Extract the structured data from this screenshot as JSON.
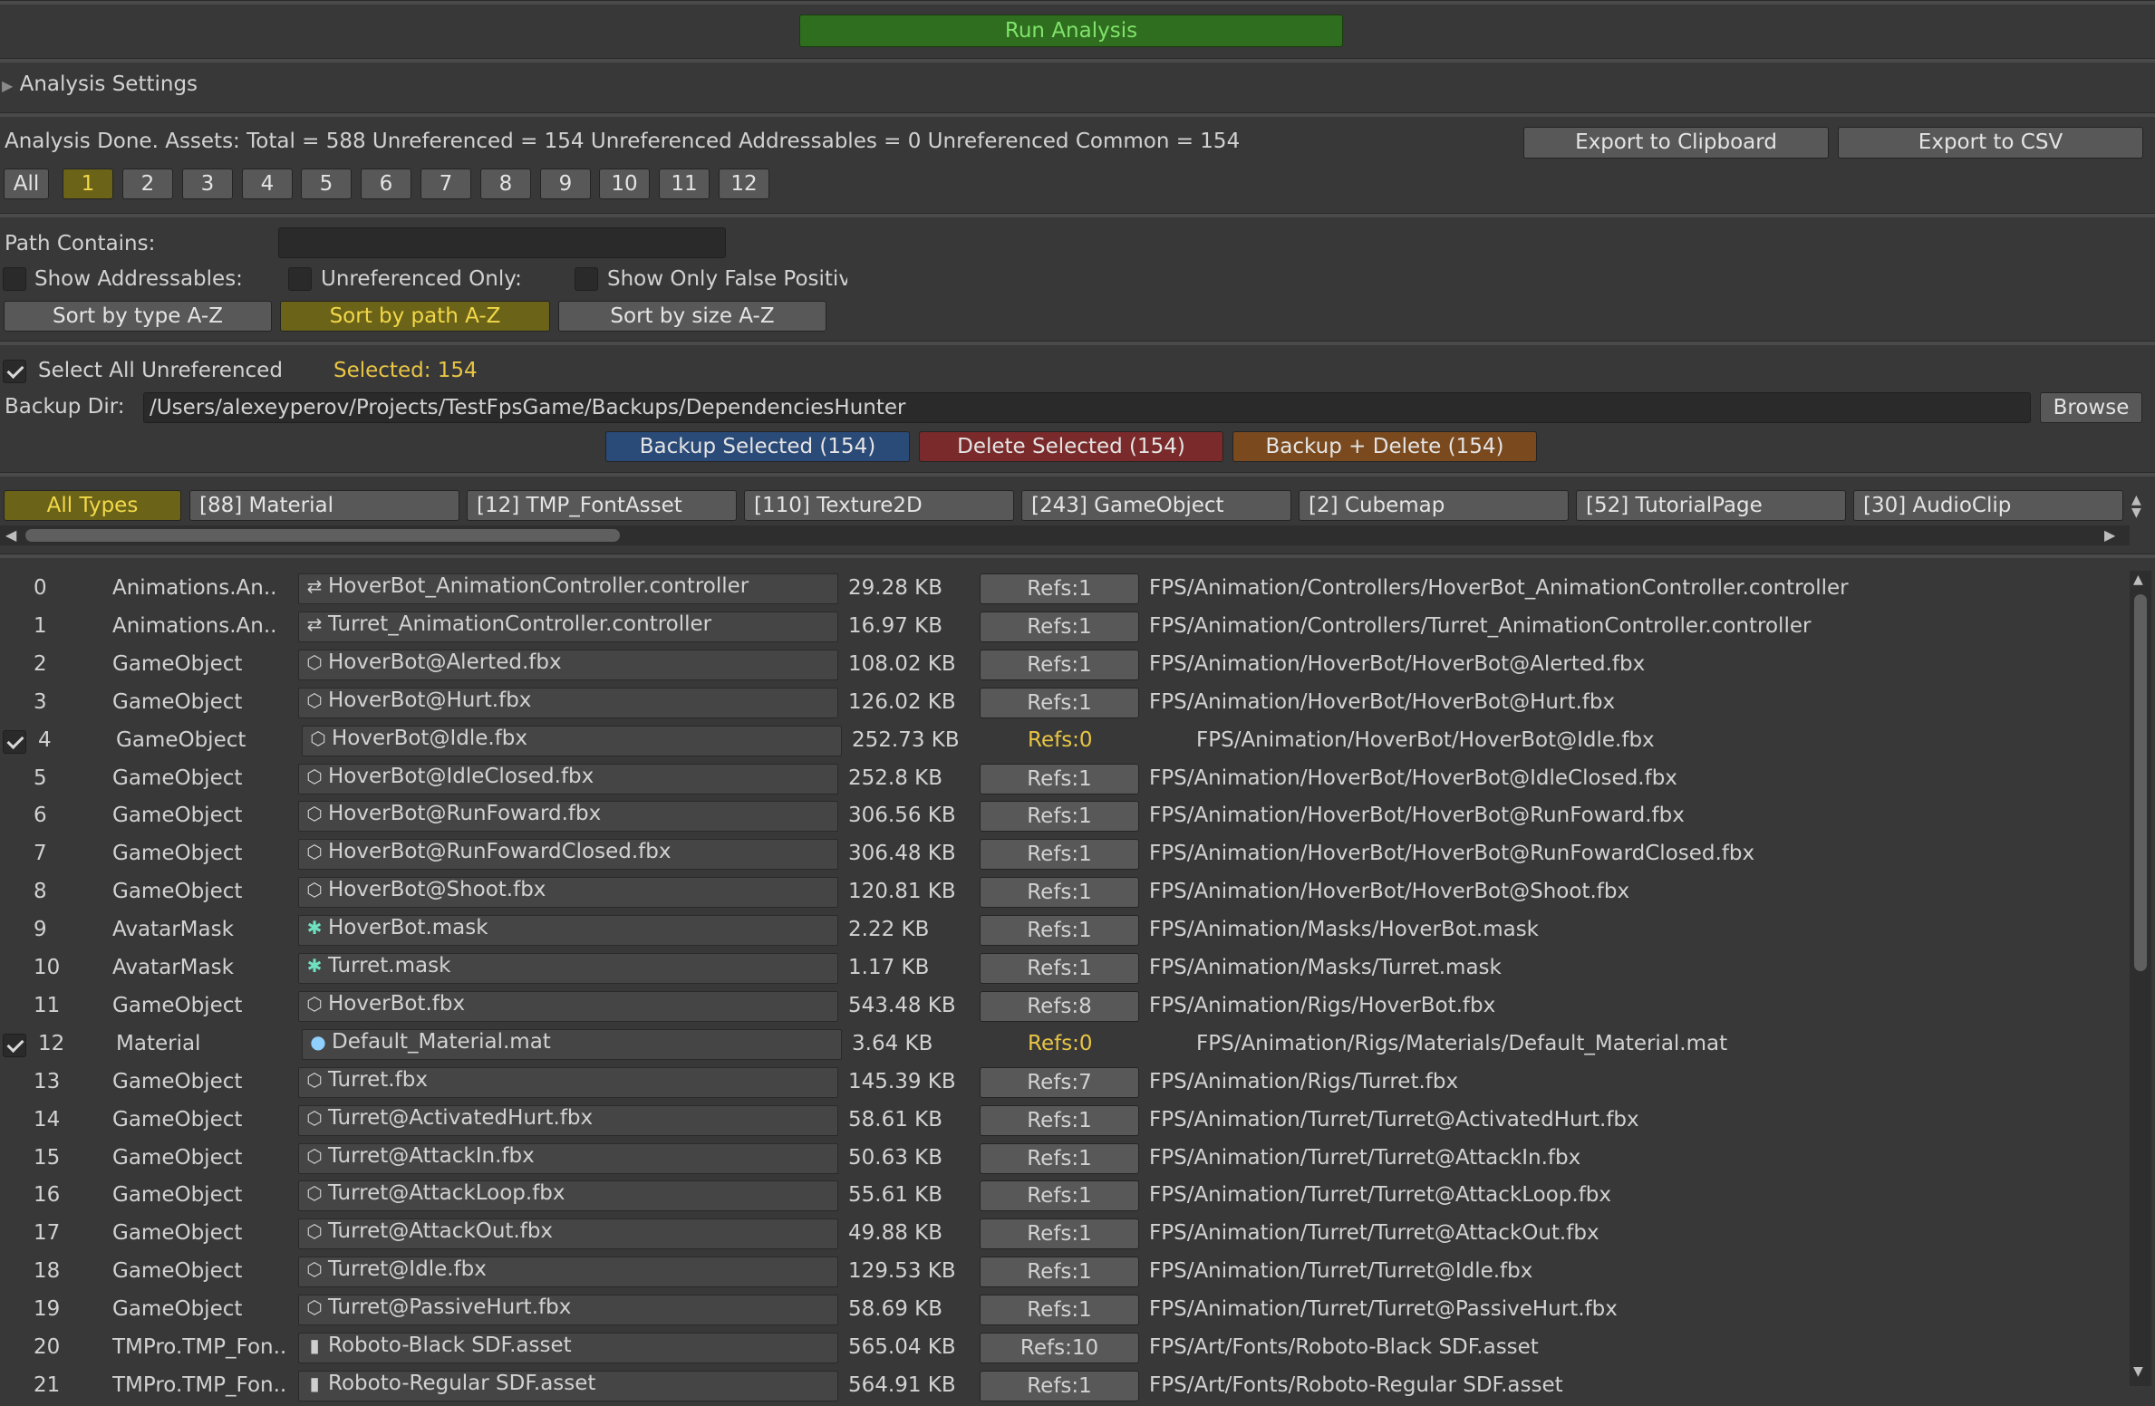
{
  "run_button": "Run Analysis",
  "settings_foldout": "Analysis Settings",
  "status_text": "Analysis Done. Assets: Total = 588 Unreferenced = 154 Unreferenced Addressables = 0 Unreferenced Common = 154",
  "export_clipboard": "Export to Clipboard",
  "export_csv": "Export to CSV",
  "pages": [
    "All",
    "1",
    "2",
    "3",
    "4",
    "5",
    "6",
    "7",
    "8",
    "9",
    "10",
    "11",
    "12"
  ],
  "active_page": "1",
  "path_contains_label": "Path Contains:",
  "path_contains_value": "",
  "show_addressables": "Show Addressables:",
  "unreferenced_only": "Unreferenced Only:",
  "show_false_positives": "Show Only False Positiv",
  "sort_type": "Sort by type A-Z",
  "sort_path": "Sort by path A-Z",
  "sort_size": "Sort by size A-Z",
  "select_all_label": "Select All Unreferenced",
  "selected_count": "Selected: 154",
  "backup_dir_label": "Backup Dir:",
  "backup_dir_value": "/Users/alexeyperov/Projects/TestFpsGame/Backups/DependenciesHunter",
  "browse": "Browse",
  "backup_selected": "Backup Selected (154)",
  "delete_selected": "Delete Selected (154)",
  "backup_delete": "Backup + Delete (154)",
  "type_tabs": [
    "All Types",
    "[88] Material",
    "[12] TMP_FontAsset",
    "[110] Texture2D",
    "[243] GameObject",
    "[2] Cubemap",
    "[52] TutorialPage",
    "[30] AudioClip"
  ],
  "colors": {
    "bg": "#383838",
    "run": "#2f6d1f",
    "accent_yellow": "#e8c545",
    "backup_blue": "#2a4a78",
    "delete_red": "#7a2a2a",
    "backup_delete_orange": "#7a4a1e",
    "active_tab": "#6b6318"
  },
  "rows": [
    {
      "idx": "0",
      "type": "Animations.An..",
      "icon": "controller-icon",
      "name": "HoverBot_AnimationController.controller",
      "size": "29.28 KB",
      "refs": "Refs:1",
      "path": "FPS/Animation/Controllers/HoverBot_AnimationController.controller",
      "checked": false
    },
    {
      "idx": "1",
      "type": "Animations.An..",
      "icon": "controller-icon",
      "name": "Turret_AnimationController.controller",
      "size": "16.97 KB",
      "refs": "Refs:1",
      "path": "FPS/Animation/Controllers/Turret_AnimationController.controller",
      "checked": false
    },
    {
      "idx": "2",
      "type": "GameObject",
      "icon": "cube-icon",
      "name": "HoverBot@Alerted.fbx",
      "size": "108.02 KB",
      "refs": "Refs:1",
      "path": "FPS/Animation/HoverBot/HoverBot@Alerted.fbx",
      "checked": false
    },
    {
      "idx": "3",
      "type": "GameObject",
      "icon": "cube-icon",
      "name": "HoverBot@Hurt.fbx",
      "size": "126.02 KB",
      "refs": "Refs:1",
      "path": "FPS/Animation/HoverBot/HoverBot@Hurt.fbx",
      "checked": false
    },
    {
      "idx": "4",
      "type": "GameObject",
      "icon": "cube-icon",
      "name": "HoverBot@Idle.fbx",
      "size": "252.73 KB",
      "refs": "Refs:0",
      "path": "FPS/Animation/HoverBot/HoverBot@Idle.fbx",
      "checked": true
    },
    {
      "idx": "5",
      "type": "GameObject",
      "icon": "cube-icon",
      "name": "HoverBot@IdleClosed.fbx",
      "size": "252.8 KB",
      "refs": "Refs:1",
      "path": "FPS/Animation/HoverBot/HoverBot@IdleClosed.fbx",
      "checked": false
    },
    {
      "idx": "6",
      "type": "GameObject",
      "icon": "cube-icon",
      "name": "HoverBot@RunFoward.fbx",
      "size": "306.56 KB",
      "refs": "Refs:1",
      "path": "FPS/Animation/HoverBot/HoverBot@RunFoward.fbx",
      "checked": false
    },
    {
      "idx": "7",
      "type": "GameObject",
      "icon": "cube-icon",
      "name": "HoverBot@RunFowardClosed.fbx",
      "size": "306.48 KB",
      "refs": "Refs:1",
      "path": "FPS/Animation/HoverBot/HoverBot@RunFowardClosed.fbx",
      "checked": false
    },
    {
      "idx": "8",
      "type": "GameObject",
      "icon": "cube-icon",
      "name": "HoverBot@Shoot.fbx",
      "size": "120.81 KB",
      "refs": "Refs:1",
      "path": "FPS/Animation/HoverBot/HoverBot@Shoot.fbx",
      "checked": false
    },
    {
      "idx": "9",
      "type": "AvatarMask",
      "icon": "avatar-icon",
      "name": "HoverBot.mask",
      "size": "2.22 KB",
      "refs": "Refs:1",
      "path": "FPS/Animation/Masks/HoverBot.mask",
      "checked": false
    },
    {
      "idx": "10",
      "type": "AvatarMask",
      "icon": "avatar-icon",
      "name": "Turret.mask",
      "size": "1.17 KB",
      "refs": "Refs:1",
      "path": "FPS/Animation/Masks/Turret.mask",
      "checked": false
    },
    {
      "idx": "11",
      "type": "GameObject",
      "icon": "cube-icon",
      "name": "HoverBot.fbx",
      "size": "543.48 KB",
      "refs": "Refs:8",
      "path": "FPS/Animation/Rigs/HoverBot.fbx",
      "checked": false
    },
    {
      "idx": "12",
      "type": "Material",
      "icon": "material-icon",
      "name": "Default_Material.mat",
      "size": "3.64 KB",
      "refs": "Refs:0",
      "path": "FPS/Animation/Rigs/Materials/Default_Material.mat",
      "checked": true
    },
    {
      "idx": "13",
      "type": "GameObject",
      "icon": "cube-icon",
      "name": "Turret.fbx",
      "size": "145.39 KB",
      "refs": "Refs:7",
      "path": "FPS/Animation/Rigs/Turret.fbx",
      "checked": false
    },
    {
      "idx": "14",
      "type": "GameObject",
      "icon": "cube-icon",
      "name": "Turret@ActivatedHurt.fbx",
      "size": "58.61 KB",
      "refs": "Refs:1",
      "path": "FPS/Animation/Turret/Turret@ActivatedHurt.fbx",
      "checked": false
    },
    {
      "idx": "15",
      "type": "GameObject",
      "icon": "cube-icon",
      "name": "Turret@AttackIn.fbx",
      "size": "50.63 KB",
      "refs": "Refs:1",
      "path": "FPS/Animation/Turret/Turret@AttackIn.fbx",
      "checked": false
    },
    {
      "idx": "16",
      "type": "GameObject",
      "icon": "cube-icon",
      "name": "Turret@AttackLoop.fbx",
      "size": "55.61 KB",
      "refs": "Refs:1",
      "path": "FPS/Animation/Turret/Turret@AttackLoop.fbx",
      "checked": false
    },
    {
      "idx": "17",
      "type": "GameObject",
      "icon": "cube-icon",
      "name": "Turret@AttackOut.fbx",
      "size": "49.88 KB",
      "refs": "Refs:1",
      "path": "FPS/Animation/Turret/Turret@AttackOut.fbx",
      "checked": false
    },
    {
      "idx": "18",
      "type": "GameObject",
      "icon": "cube-icon",
      "name": "Turret@Idle.fbx",
      "size": "129.53 KB",
      "refs": "Refs:1",
      "path": "FPS/Animation/Turret/Turret@Idle.fbx",
      "checked": false
    },
    {
      "idx": "19",
      "type": "GameObject",
      "icon": "cube-icon",
      "name": "Turret@PassiveHurt.fbx",
      "size": "58.69 KB",
      "refs": "Refs:1",
      "path": "FPS/Animation/Turret/Turret@PassiveHurt.fbx",
      "checked": false
    },
    {
      "idx": "20",
      "type": "TMPro.TMP_Fon..",
      "icon": "file-icon",
      "name": "Roboto-Black SDF.asset",
      "size": "565.04 KB",
      "refs": "Refs:10",
      "path": "FPS/Art/Fonts/Roboto-Black SDF.asset",
      "checked": false
    },
    {
      "idx": "21",
      "type": "TMPro.TMP_Fon..",
      "icon": "file-icon",
      "name": "Roboto-Regular SDF.asset",
      "size": "564.91 KB",
      "refs": "Refs:1",
      "path": "FPS/Art/Fonts/Roboto-Regular SDF.asset",
      "checked": false
    }
  ]
}
